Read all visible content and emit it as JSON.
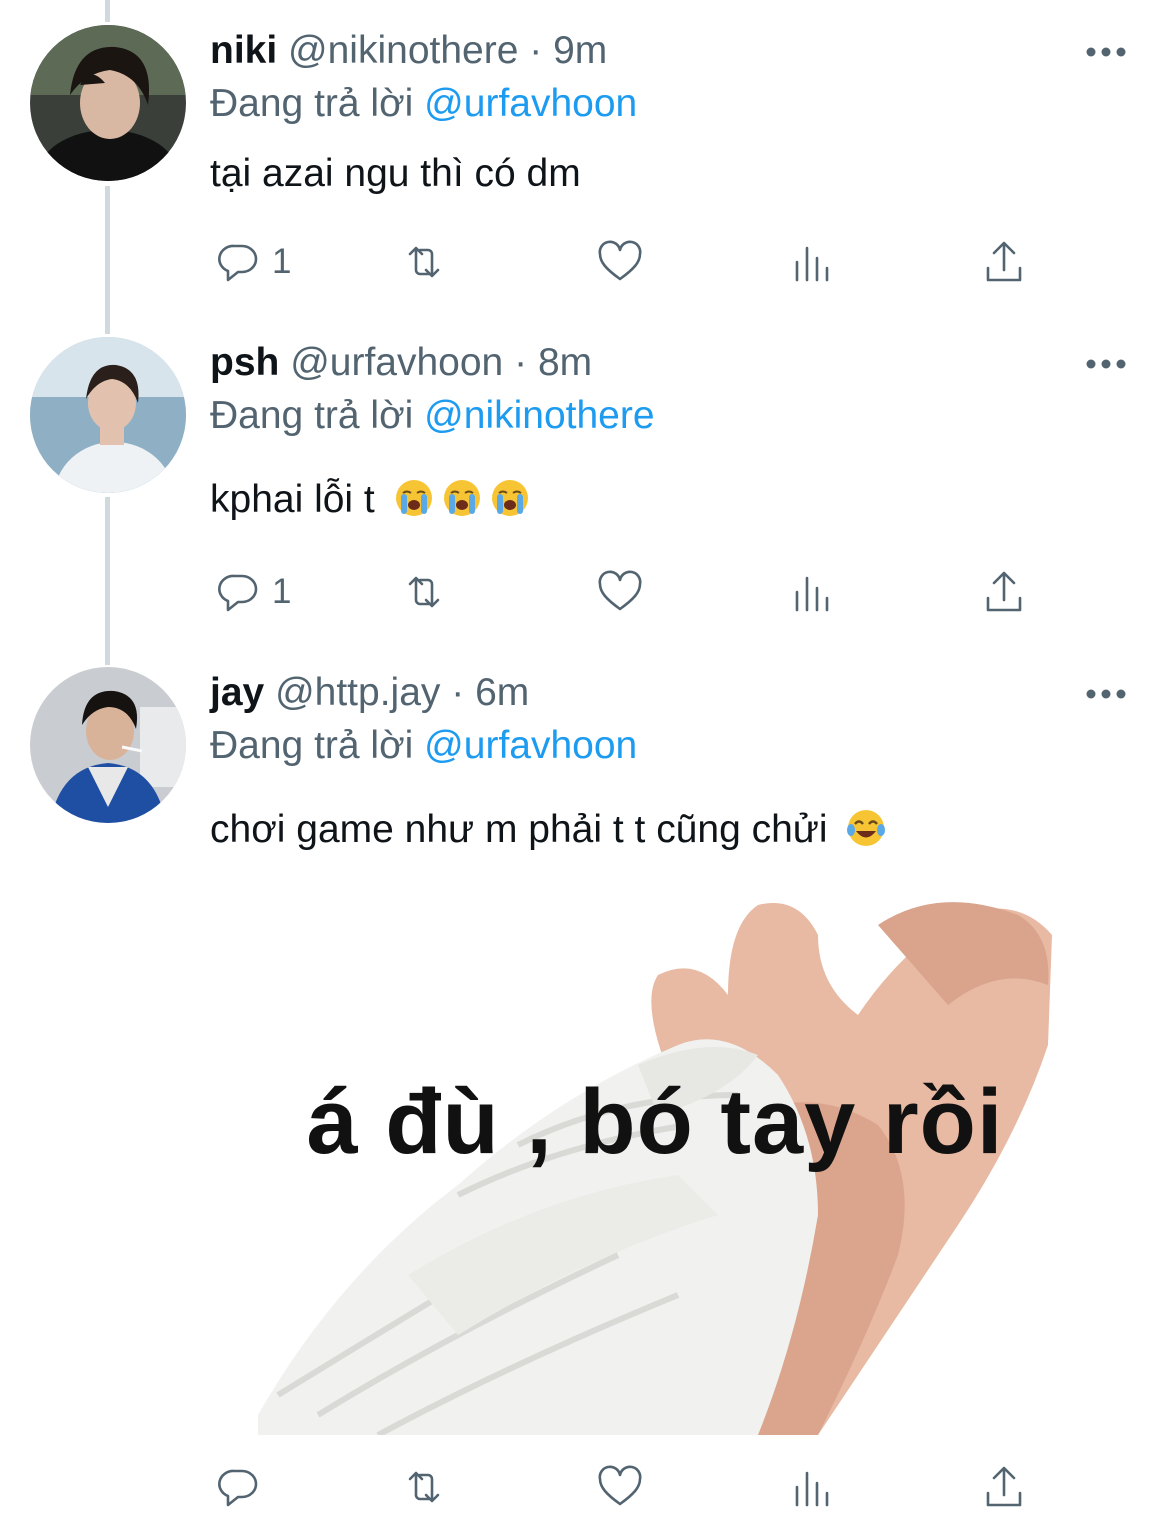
{
  "tweets": [
    {
      "name": "niki",
      "handle": "@nikinothere",
      "separator": "·",
      "time": "9m",
      "reply_prefix": "Đang trả lời",
      "reply_to": "@urfavhoon",
      "text": "tại azai ngu thì có dm",
      "emojis": [],
      "replies": "1"
    },
    {
      "name": "psh",
      "handle": "@urfavhoon",
      "separator": "·",
      "time": "8m",
      "reply_prefix": "Đang trả lời",
      "reply_to": "@nikinothere",
      "text": "kphai lỗi t",
      "emojis": [
        "loudly-crying-face",
        "loudly-crying-face",
        "loudly-crying-face"
      ],
      "replies": "1"
    },
    {
      "name": "jay",
      "handle": "@http.jay",
      "separator": "·",
      "time": "6m",
      "reply_prefix": "Đang trả lời",
      "reply_to": "@urfavhoon",
      "text": "chơi game như m phải t t cũng chửi",
      "emojis": [
        "face-with-tears-of-joy"
      ],
      "replies": "",
      "media_caption": "á đù , bó tay rồi"
    }
  ],
  "icons": [
    "reply-icon",
    "retweet-icon",
    "like-icon",
    "views-icon",
    "share-icon",
    "more-icon"
  ],
  "colors": {
    "text": "#0f1419",
    "secondary": "#536471",
    "mention": "#1d9bf0",
    "thread_line": "#cfd9de"
  }
}
